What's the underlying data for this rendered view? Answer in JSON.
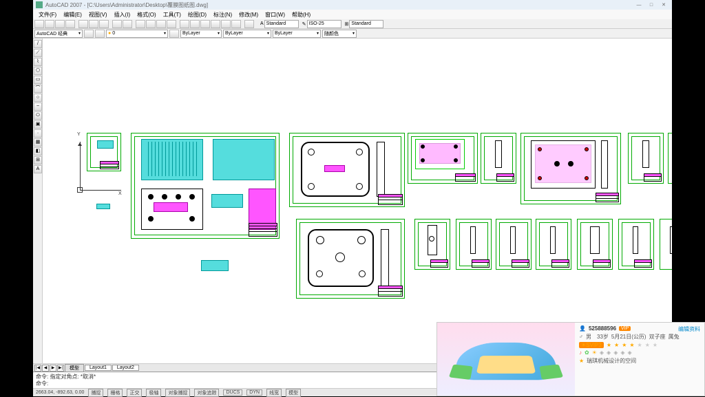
{
  "title": "AutoCAD 2007 - [C:\\Users\\Administrator\\Desktop\\覆膜图纸图.dwg]",
  "menu": [
    "文件(F)",
    "编辑(E)",
    "视图(V)",
    "插入(I)",
    "格式(O)",
    "工具(T)",
    "绘图(D)",
    "标注(N)",
    "修改(M)",
    "窗口(W)",
    "帮助(H)"
  ],
  "layer_combo": "AutoCAD 经典",
  "layer_current": "0",
  "style1": "Standard",
  "style2": "ISO-25",
  "style3": "Standard",
  "prop_layer": "ByLayer",
  "prop_color": "ByLayer",
  "prop_ltype": "ByLayer",
  "prop_lweight": "随颜色",
  "tabs": {
    "nav": [
      "|◀",
      "◀",
      "▶",
      "▶|"
    ],
    "items": [
      "模型",
      "Layout1",
      "Layout2"
    ],
    "active": 0
  },
  "cmd": {
    "line1": "命令: 指定对角点: *取消*",
    "line2": "命令:"
  },
  "status": {
    "coords": "2663.04, -892.63, 0.00",
    "toggles": [
      "捕捉",
      "栅格",
      "正交",
      "极轴",
      "对象捕捉",
      "对象追踪",
      "DUCS",
      "DYN",
      "线宽",
      "模型"
    ]
  },
  "profile": {
    "uid": "525888596",
    "vip_badge": "VIP",
    "gender_age": "男　33岁",
    "birth": "5月21日(公历)",
    "zodiac_cn": "双子座",
    "zodiac_animal": "属兔",
    "level_badge": "☀SVIP3",
    "signature": "瑞琪机械设计的空间",
    "edit": "编辑资料"
  }
}
